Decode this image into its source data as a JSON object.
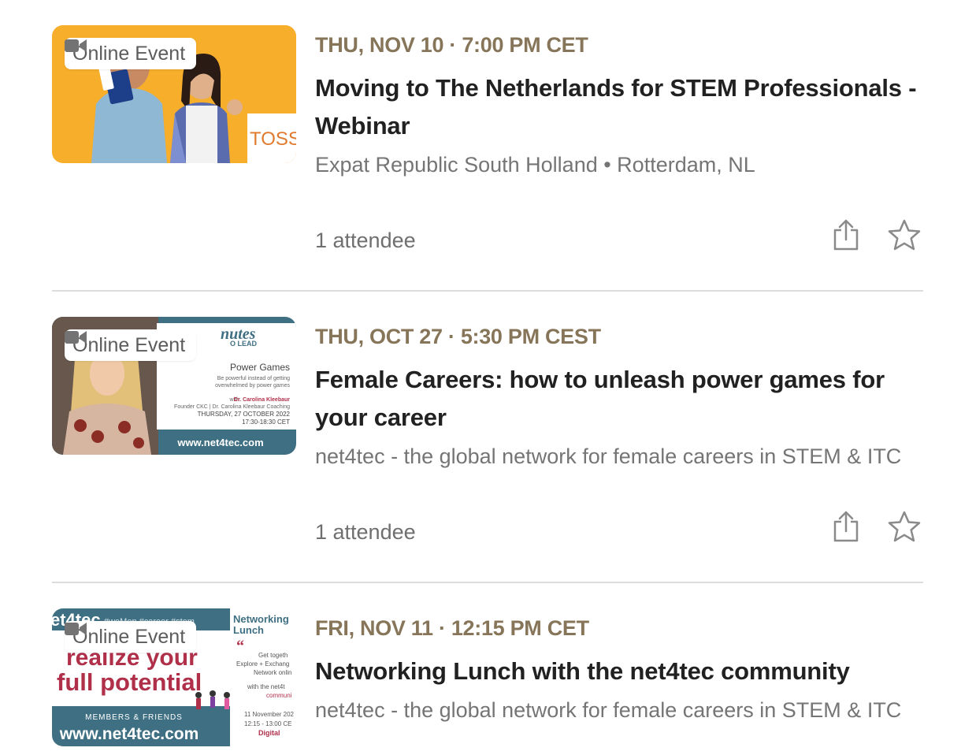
{
  "events": [
    {
      "badge": "Online Event",
      "date": "THU, NOV 10 · 7:00 PM CET",
      "title": "Moving to The Netherlands for STEM Professionals - Webinar",
      "group": "Expat Republic South Holland • Rotterdam, NL",
      "attendees": "1 attendee",
      "thumb_text": "TOSS",
      "thumb_color": "#f5a623"
    },
    {
      "badge": "Online Event",
      "date": "THU, OCT 27 · 5:30 PM CEST",
      "title": "Female Careers: how to unleash power games for your career",
      "group": "net4tec - the global network for female careers in STEM & ITC",
      "attendees": "1 attendee",
      "thumb_text": {
        "heading": "nutes",
        "subheading": "O LEAD",
        "topic": "Power Games",
        "line1": "Be powerful instead of getting",
        "line2": "overwhelmed by power games",
        "with": "with",
        "speaker": "Dr. Carolina Kleebaur",
        "role": "Founder CKC | Dr. Carolina Kleebaur Coaching",
        "day": "THURSDAY,  27 OCTOBER 2022",
        "time": "17:30-18:30 CET",
        "url": "www.net4tec.com"
      },
      "thumb_color": "#3f6f82"
    },
    {
      "badge": "Online Event",
      "date": "FRI, NOV 11 · 12:15 PM CET",
      "title": "Networking Lunch with the net4tec community",
      "group": "net4tec - the global network for female careers in STEM & ITC",
      "thumb_text": {
        "brand": "et4tec",
        "tags": "#weMen #career #stem",
        "headline1": "realize your",
        "headline2": "full potential",
        "members": "MEMBERS & FRIENDS",
        "url": "www.net4tec.com",
        "side_title1": "Networking",
        "side_title2": "Lunch",
        "side_line1": "Get togeth",
        "side_line2": "Explore + Exchang",
        "side_line3": "Network onlin",
        "side_line4": "with the net4t",
        "side_line5": "communi",
        "side_date": "11 November 202",
        "side_time": "12:15 - 13:00 CE",
        "side_digital": "Digital"
      },
      "thumb_color": "#3f6f82"
    }
  ],
  "colors": {
    "date": "#877559",
    "title": "#212121",
    "meta": "#757575",
    "divider": "#dcdcdc"
  },
  "icons": [
    "video-camera-icon",
    "share-icon",
    "star-icon"
  ]
}
